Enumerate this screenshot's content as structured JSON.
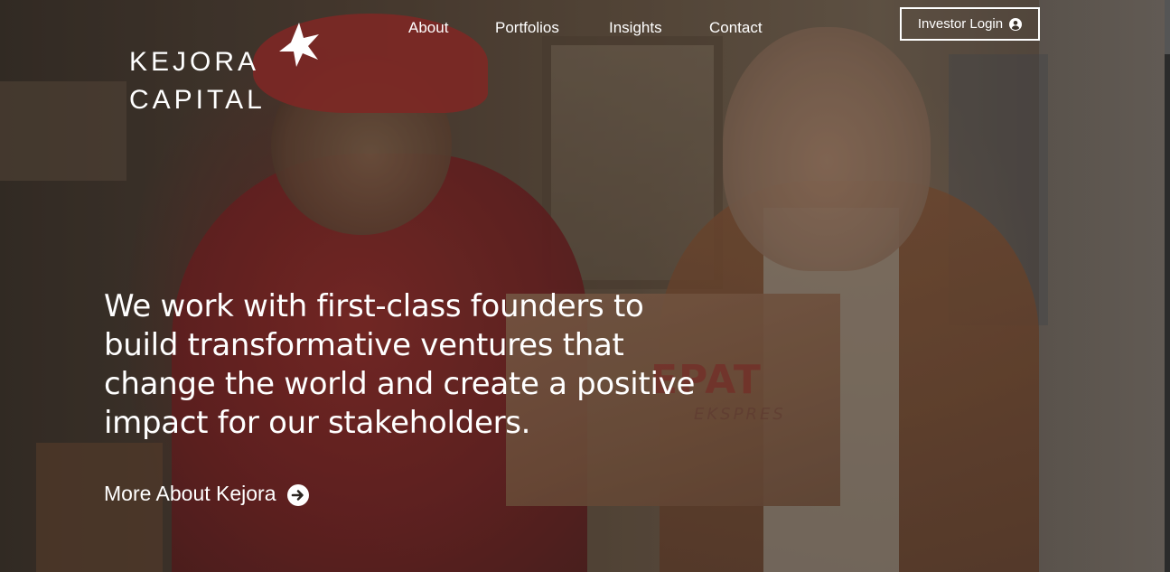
{
  "brand": {
    "logo_line1": "KEJORA",
    "logo_line2": "CAPITAL",
    "logo_icon": "star-icon"
  },
  "nav": {
    "items": [
      {
        "label": "About"
      },
      {
        "label": "Portfolios"
      },
      {
        "label": "Insights"
      },
      {
        "label": "Contact"
      }
    ],
    "login_label": "Investor Login",
    "login_icon": "user-circle-icon"
  },
  "hero": {
    "headline": "We work with first-class founders to build transformative ventures that change the world and create a positive impact for our stakeholders.",
    "cta_label": "More About Kejora",
    "cta_icon": "arrow-circle-right-icon",
    "box_print_main": "EPAT",
    "box_print_sub": "EKSPRES"
  },
  "colors": {
    "text": "#ffffff",
    "accent_red": "#a8312e"
  }
}
